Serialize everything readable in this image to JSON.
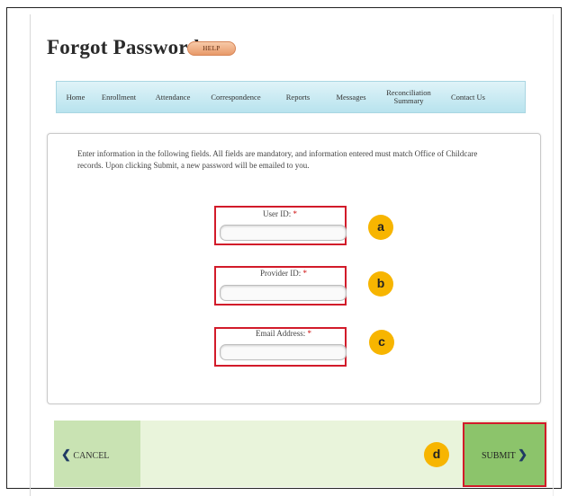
{
  "page": {
    "title": "Forgot Password",
    "help_label": "HELP"
  },
  "nav": {
    "items": [
      {
        "label": "Home"
      },
      {
        "label": "Enrollment"
      },
      {
        "label": "Attendance"
      },
      {
        "label": "Correspondence"
      },
      {
        "label": "Reports"
      },
      {
        "label": "Messages"
      },
      {
        "label": "Reconciliation Summary"
      },
      {
        "label": "Contact Us"
      }
    ]
  },
  "form": {
    "instructions": "Enter information in the following fields. All fields are mandatory, and information entered must match Office of Childcare records. Upon clicking Submit, a new password will be emailed to you.",
    "required_mark": "*",
    "fields": [
      {
        "label": "User ID:",
        "value": "",
        "marker": "a"
      },
      {
        "label": "Provider ID:",
        "value": "",
        "marker": "b"
      },
      {
        "label": "Email Address:",
        "value": "",
        "marker": "c"
      }
    ]
  },
  "actions": {
    "cancel_label": "CANCEL",
    "submit_label": "SUBMIT",
    "submit_marker": "d",
    "cancel_icon": "chevron-left-icon",
    "submit_icon": "chevron-right-icon"
  },
  "colors": {
    "highlight": "#d21b2a",
    "marker": "#f7b500",
    "submit_bg": "#8cc46b",
    "nav_bg": "#c8ebf3"
  }
}
